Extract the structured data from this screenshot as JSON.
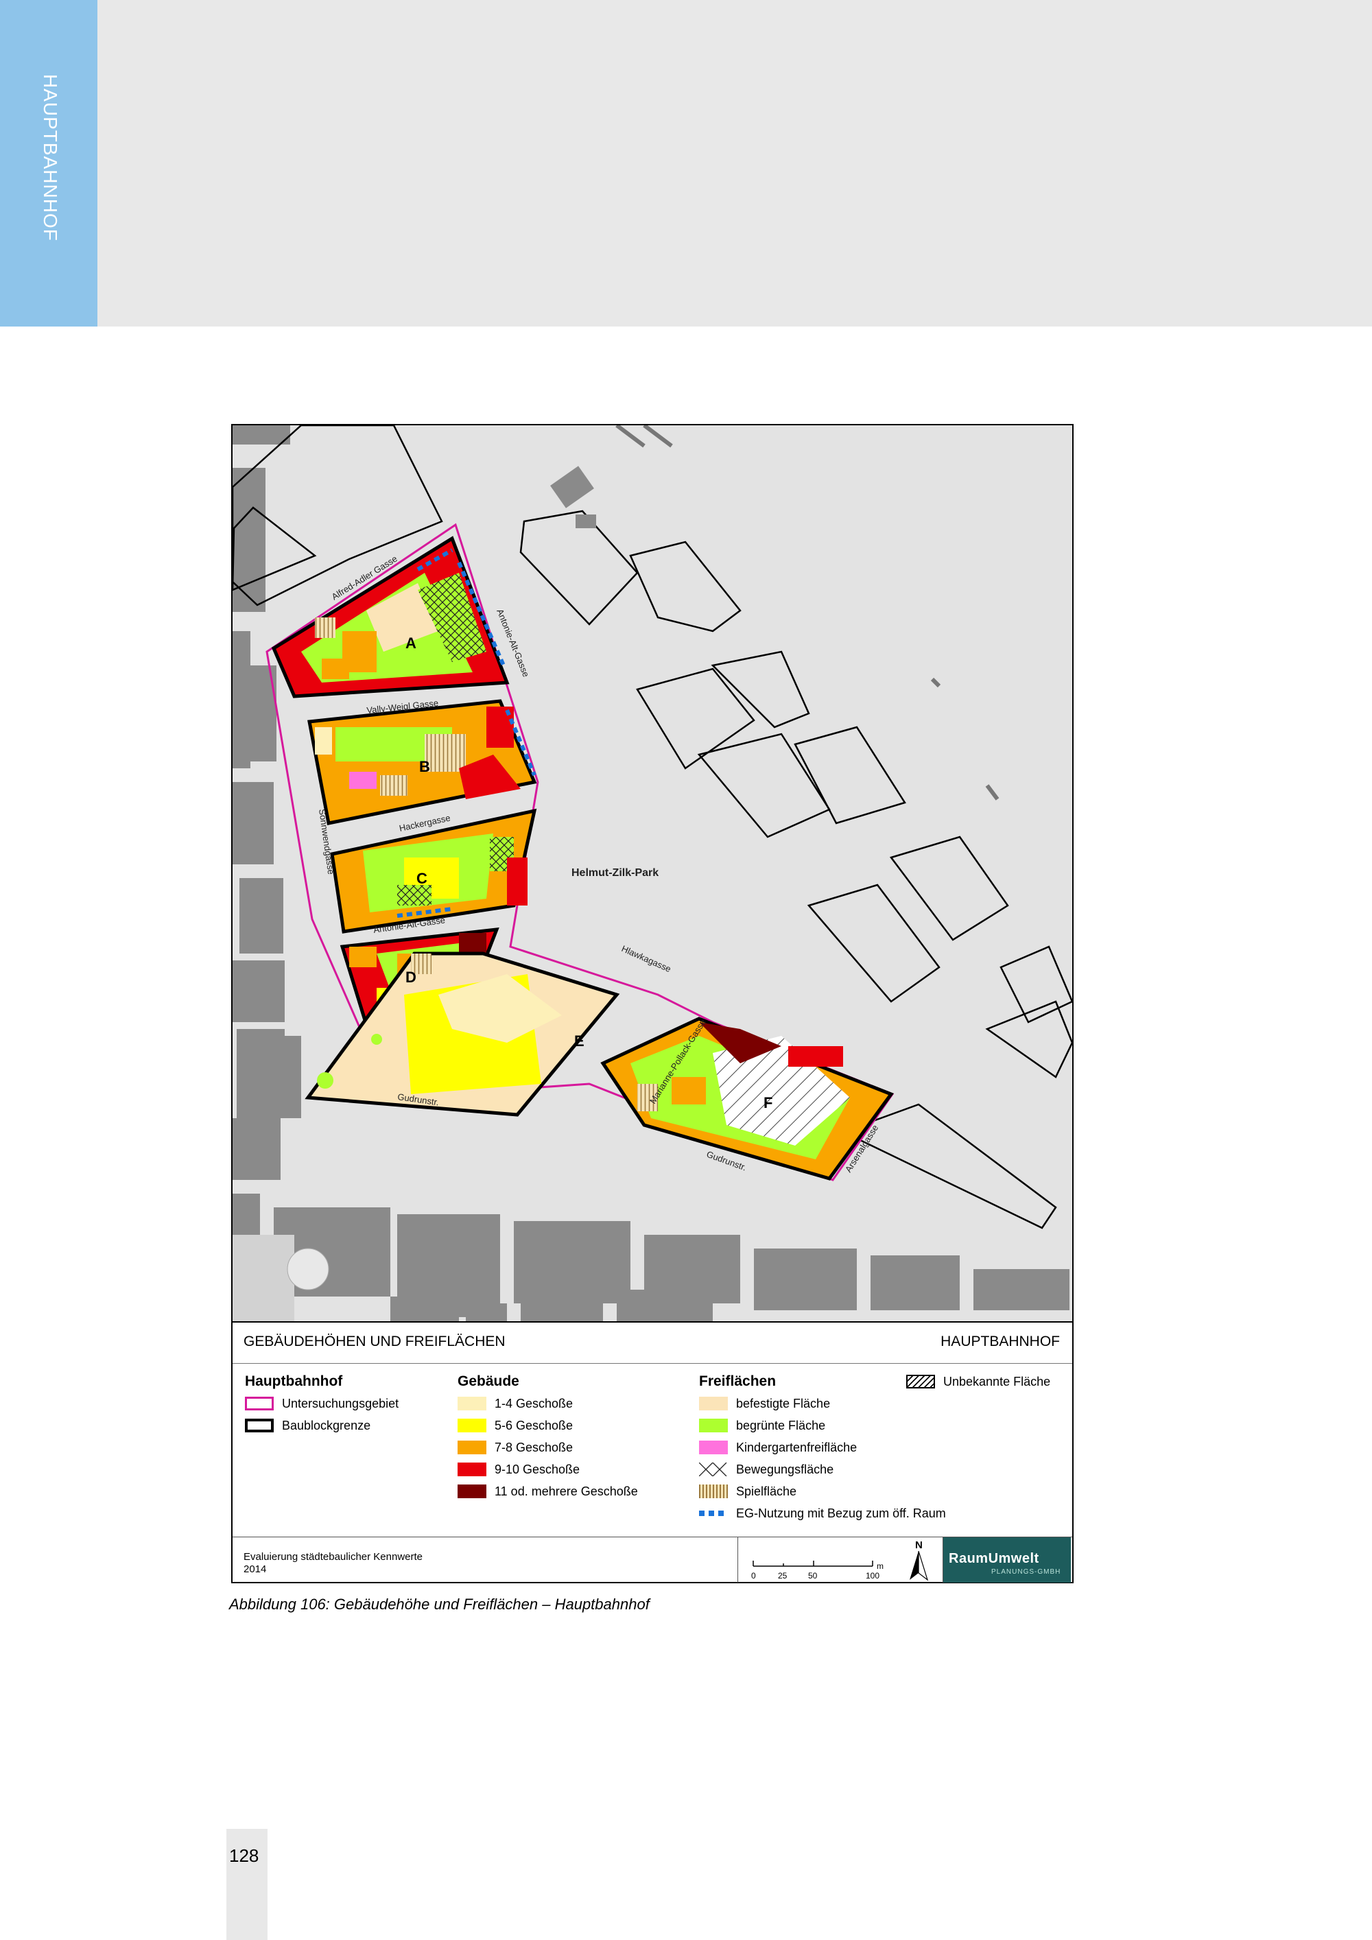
{
  "side_tab": {
    "label": "HAUPTBAHNHOF"
  },
  "map": {
    "park_label": "Helmut-Zilk-Park",
    "streets": {
      "alfred_adler": "Alfred-Adler Gasse",
      "antonie_alt_right": "Antonie-Alt-Gasse",
      "vally_weigl": "Vally-Weigl Gasse",
      "hackergasse": "Hackergasse",
      "sonnwendgasse": "Sonnwendgasse",
      "antonie_alt_bottom": "Antonie-Alt-Gasse",
      "hlawkagasse": "Hlawkagasse",
      "marianne_pollack": "Marianne-Pollack-Gasse",
      "gudrunstr_left": "Gudrunstr.",
      "gudrunstr_right": "Gudrunstr.",
      "arsenal": "Arsenalgasse"
    },
    "blocks": [
      "A",
      "B",
      "C",
      "D",
      "E",
      "F"
    ]
  },
  "title_row": {
    "left": "GEBÄUDEHÖHEN UND FREIFLÄCHEN",
    "right": "HAUPTBAHNHOF"
  },
  "legend": {
    "col1": {
      "heading": "Hauptbahnhof",
      "items": [
        "Untersuchungsgebiet",
        "Baublockgrenze"
      ]
    },
    "col2": {
      "heading": "Gebäude",
      "items": [
        "1-4 Geschoße",
        "5-6 Geschoße",
        "7-8 Geschoße",
        "9-10 Geschoße",
        "11 od. mehrere Geschoße"
      ]
    },
    "col3": {
      "heading": "Freiflächen",
      "items": [
        "befestigte Fläche",
        "begrünte Fläche",
        "Kindergartenfreifläche",
        "Bewegungsfläche",
        "Spielfläche",
        "EG-Nutzung mit Bezug zum öff. Raum"
      ]
    },
    "col4": {
      "items": [
        "Unbekannte Fläche"
      ]
    }
  },
  "colors": {
    "study_area": "#d6199b",
    "floors_1_4": "#fdf0b8",
    "floors_5_6": "#ffff00",
    "floors_7_8": "#f9a500",
    "floors_9_10": "#e8000b",
    "floors_11_plus": "#7a0000",
    "paved": "#fbe4b8",
    "green": "#adff2f",
    "kindergarten": "#ff72dd",
    "eg_usage": "#1a73d9"
  },
  "footer": {
    "line1": "Evaluierung städtebaulicher Kennwerte",
    "line2": "2014",
    "scale_labels": [
      "0",
      "25",
      "50",
      "100"
    ],
    "scale_unit": "m",
    "north": "N",
    "logo": "RaumUmwelt",
    "logo_sub": "PLANUNGS-GMBH"
  },
  "caption": "Abbildung 106:  Gebäudehöhe und Freiflächen – Hauptbahnhof",
  "page_number": "128"
}
